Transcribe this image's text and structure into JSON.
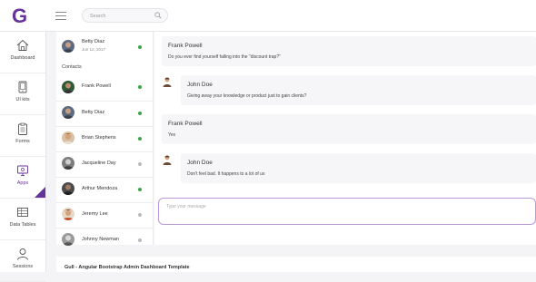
{
  "brand": {
    "logo_letter": "G",
    "accent": "#663399"
  },
  "search": {
    "placeholder": "Search",
    "value": ""
  },
  "sidebar": {
    "items": [
      {
        "label": "Dashboard",
        "icon": "home-icon"
      },
      {
        "label": "UI kits",
        "icon": "phone-icon"
      },
      {
        "label": "Forms",
        "icon": "clipboard-icon"
      },
      {
        "label": "Apps",
        "icon": "computer-icon"
      },
      {
        "label": "Data Tables",
        "icon": "table-icon"
      },
      {
        "label": "Sessions",
        "icon": "user-icon"
      }
    ],
    "active_index": 3
  },
  "chat_list": {
    "current": {
      "name": "Betty Diaz",
      "date": "Jun 12, 2017",
      "status": "online"
    },
    "contacts_label": "Contacts",
    "contacts": [
      {
        "name": "Frank Powell",
        "status": "online"
      },
      {
        "name": "Betty Diaz",
        "status": "online"
      },
      {
        "name": "Brian Stephens",
        "status": "online"
      },
      {
        "name": "Jacqueline Day",
        "status": "offline"
      },
      {
        "name": "Arthur Mendoza",
        "status": "online"
      },
      {
        "name": "Jeremy Lee",
        "status": "offline"
      },
      {
        "name": "Johnny Newman",
        "status": "offline"
      }
    ]
  },
  "messages": [
    {
      "name": "Frank Powell",
      "text": "Do you ever find yourself falling into the \"discount trap?\""
    },
    {
      "name": "John Doe",
      "text": "Giving away your knowledge or product just to gain clients?"
    },
    {
      "name": "Frank Powell",
      "text": "Yes"
    },
    {
      "name": "John Doe",
      "text": "Don't feel bad. It happens to a lot of us"
    }
  ],
  "composer": {
    "placeholder": "Type your message",
    "value": ""
  },
  "footer": {
    "text": "Gull - Angular Bootstrap Admin Dashboard Template"
  },
  "colors": {
    "online": "#3aa64b",
    "offline": "#b9b9c2"
  }
}
